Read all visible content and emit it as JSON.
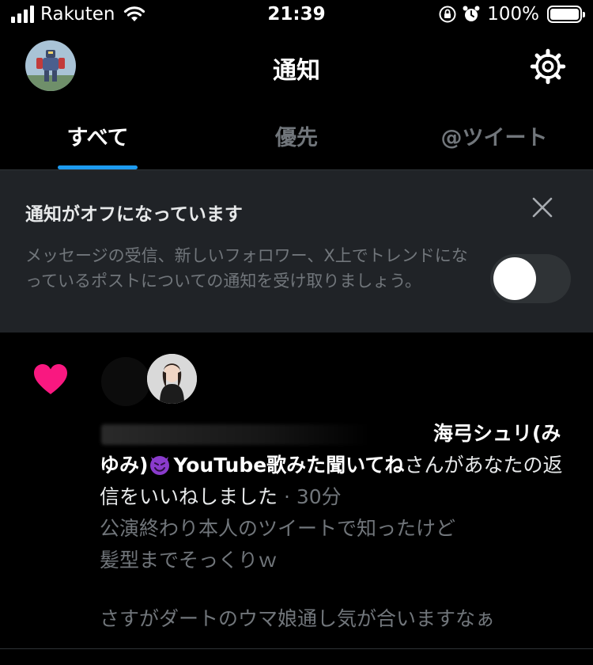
{
  "status_bar": {
    "carrier": "Rakuten",
    "time": "21:39",
    "battery": "100%"
  },
  "header": {
    "title": "通知",
    "avatar_icon": "robot-avatar-icon",
    "settings_icon": "gear-icon"
  },
  "tabs": [
    {
      "label": "すべて",
      "active": true
    },
    {
      "label": "優先",
      "active": false
    },
    {
      "label": "@ツイート",
      "active": false
    }
  ],
  "banner": {
    "title": "通知がオフになっています",
    "description": "メッセージの受信、新しいフォロワー、X上でトレンドになっているポストについての通知を受け取りましょう。",
    "toggle_on": false
  },
  "notification": {
    "icon": "heart-icon",
    "user_name": "海弓シュリ(みゆみ)",
    "emoji_icon": "smiling-devil-emoji-icon",
    "user_name_suffix": "YouTube歌みた聞いてね",
    "action_text": "さんがあなたの返信をいいねしました",
    "time": "· 30分",
    "quote_lines": [
      "公演終わり本人のツイートで知ったけど",
      "髪型までそっくりｗ",
      "さすがダートのウマ娘通し気が合いますなぁ"
    ]
  },
  "colors": {
    "accent": "#1d9bf0",
    "like": "#f91880",
    "banner_bg": "#202327",
    "muted_text": "#71767b"
  }
}
